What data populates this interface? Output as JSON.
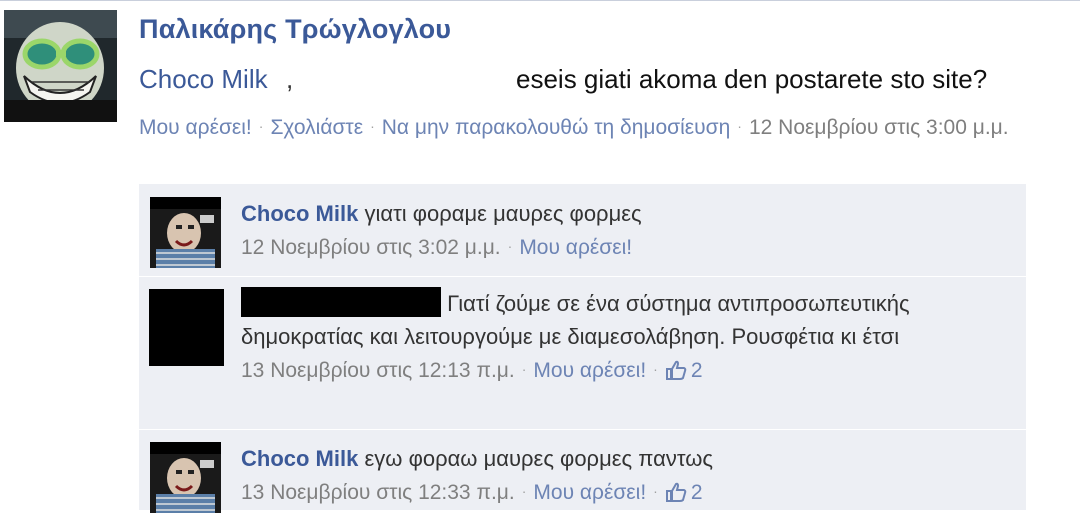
{
  "post": {
    "author": "Παλικάρης Τρώγλογλου",
    "mention": "Choco Milk",
    "comma": ",",
    "message": "eseis giati akoma den postarete sto site?",
    "actions": {
      "like": "Μου αρέσει!",
      "comment": "Σχολιάστε",
      "unfollow": "Να μην παρακολουθώ τη δημοσίευση",
      "timestamp": "12 Νοεμβρίου στις 3:00 μ.μ."
    }
  },
  "comments": [
    {
      "author": "Choco Milk",
      "text": "γιατι φοραμε μαυρες φορμες",
      "timestamp": "12 Νοεμβρίου στις 3:02 μ.μ.",
      "like_label": "Μου αρέσει!",
      "likes": ""
    },
    {
      "author": "",
      "text": "Γιατί ζούμε σε ένα σύστημα αντιπροσωπευτικής δημοκρατίας και λειτουργούμε με διαμεσολάβηση. Ρουσφέτια κι έτσι",
      "timestamp": "13 Νοεμβρίου στις 12:13 π.μ.",
      "like_label": "Μου αρέσει!",
      "likes": "2"
    },
    {
      "author": "Choco Milk",
      "text": "εγω φοραω μαυρες φορμες παντως",
      "timestamp": "13 Νοεμβρίου στις 12:33 π.μ.",
      "like_label": "Μου αρέσει!",
      "likes": "2"
    }
  ],
  "colors": {
    "link": "#3b5998",
    "action_link": "#6d84b4",
    "comment_bg": "#edeff4",
    "meta_text": "#7f7f7f"
  },
  "icons": [
    "post-author-avatar",
    "commenter-avatar",
    "thumbs-up-icon",
    "middle-dot-separator"
  ]
}
